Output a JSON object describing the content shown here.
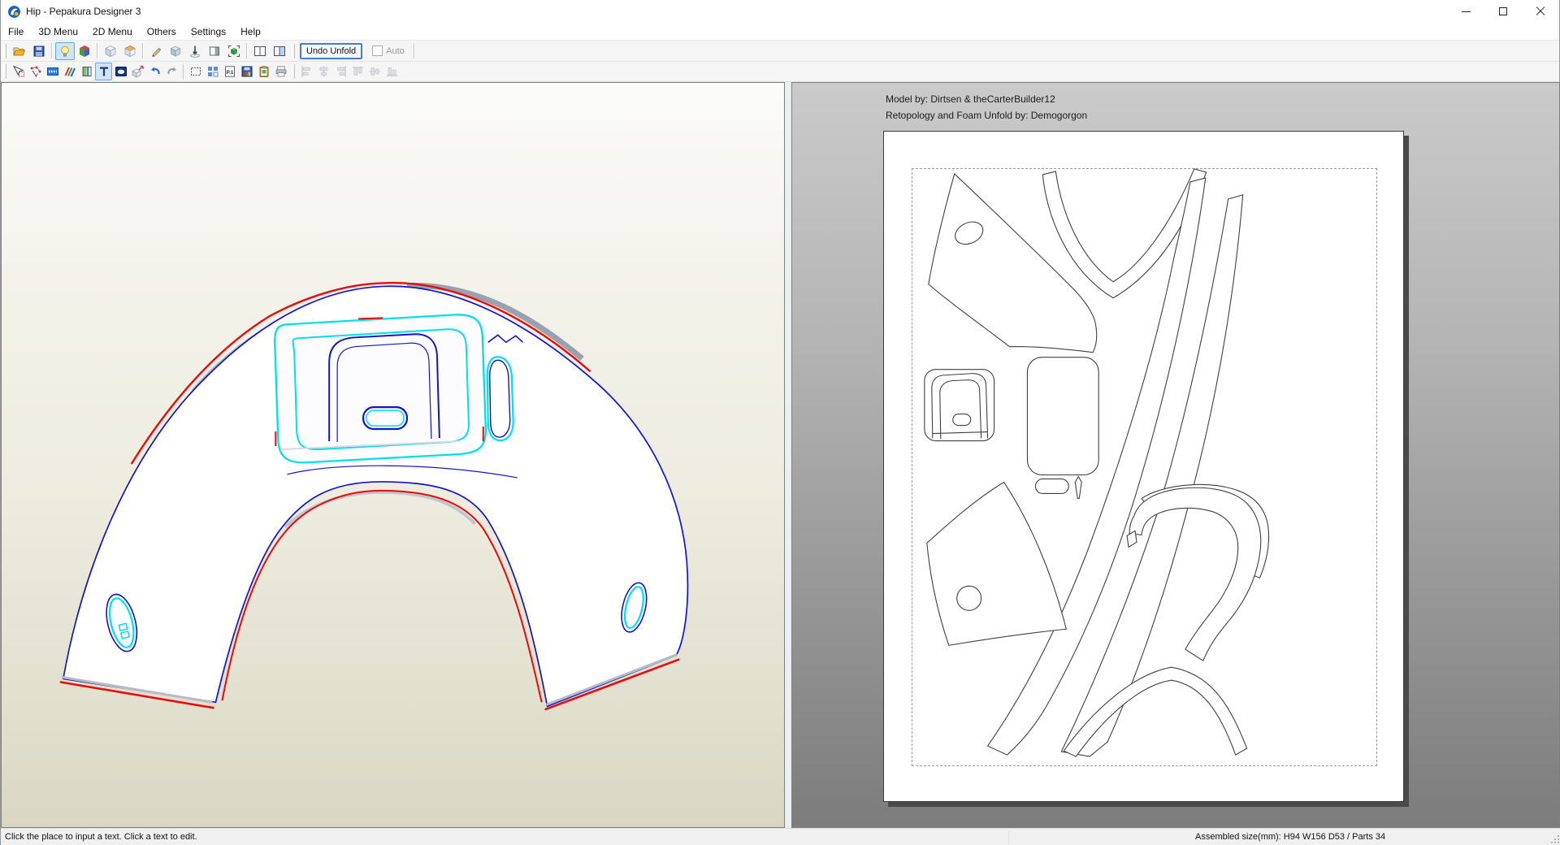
{
  "window": {
    "title": "Hip - Pepakura Designer 3"
  },
  "menubar": {
    "items": [
      "File",
      "3D Menu",
      "2D Menu",
      "Others",
      "Settings",
      "Help"
    ]
  },
  "toolbar1": {
    "undo_unfold_label": "Undo Unfold",
    "auto_label": "Auto",
    "icons": [
      "open-folder",
      "save-floppy",
      "light-bulb",
      "texture-cube",
      "box-plain",
      "box-orange",
      "edit-pencil",
      "solid-box",
      "pin-vertex",
      "side-panel",
      "select-solid",
      "split-view-left",
      "split-view-right"
    ]
  },
  "toolbar2": {
    "page_icon_text": "P.1",
    "icons": [
      "select-cursor",
      "edge-select",
      "texture-band",
      "color-pens",
      "material-panel",
      "text-tool",
      "image-tool",
      "move-part",
      "undo-rotate",
      "redo-rotate",
      "marquee-select",
      "arrange-parts",
      "page-number",
      "export-image",
      "copy-clipboard",
      "print",
      "align-left",
      "align-center-horizontal",
      "align-right",
      "align-top",
      "align-middle",
      "align-bottom"
    ]
  },
  "viewport2d": {
    "annotation_line1": "Model by: Dirtsen & theCarterBuilder12",
    "annotation_line2": "Retopology and Foam Unfold by: Demogorgon"
  },
  "statusbar": {
    "left_text": "Click the place to input a text. Click a text to edit.",
    "right_text": "Assembled size(mm): H94 W156 D53 / Parts 34"
  },
  "colors": {
    "edge_blue": "#1414cc",
    "edge_red": "#e80b0b",
    "edge_cyan": "#00dff0",
    "selected_button_border": "#66a7e8",
    "selected_button_bg": "#cde6f7",
    "pattern_outline": "#404040",
    "pane2d_top": "#cacaca",
    "pane2d_bottom": "#7c7c7c"
  }
}
